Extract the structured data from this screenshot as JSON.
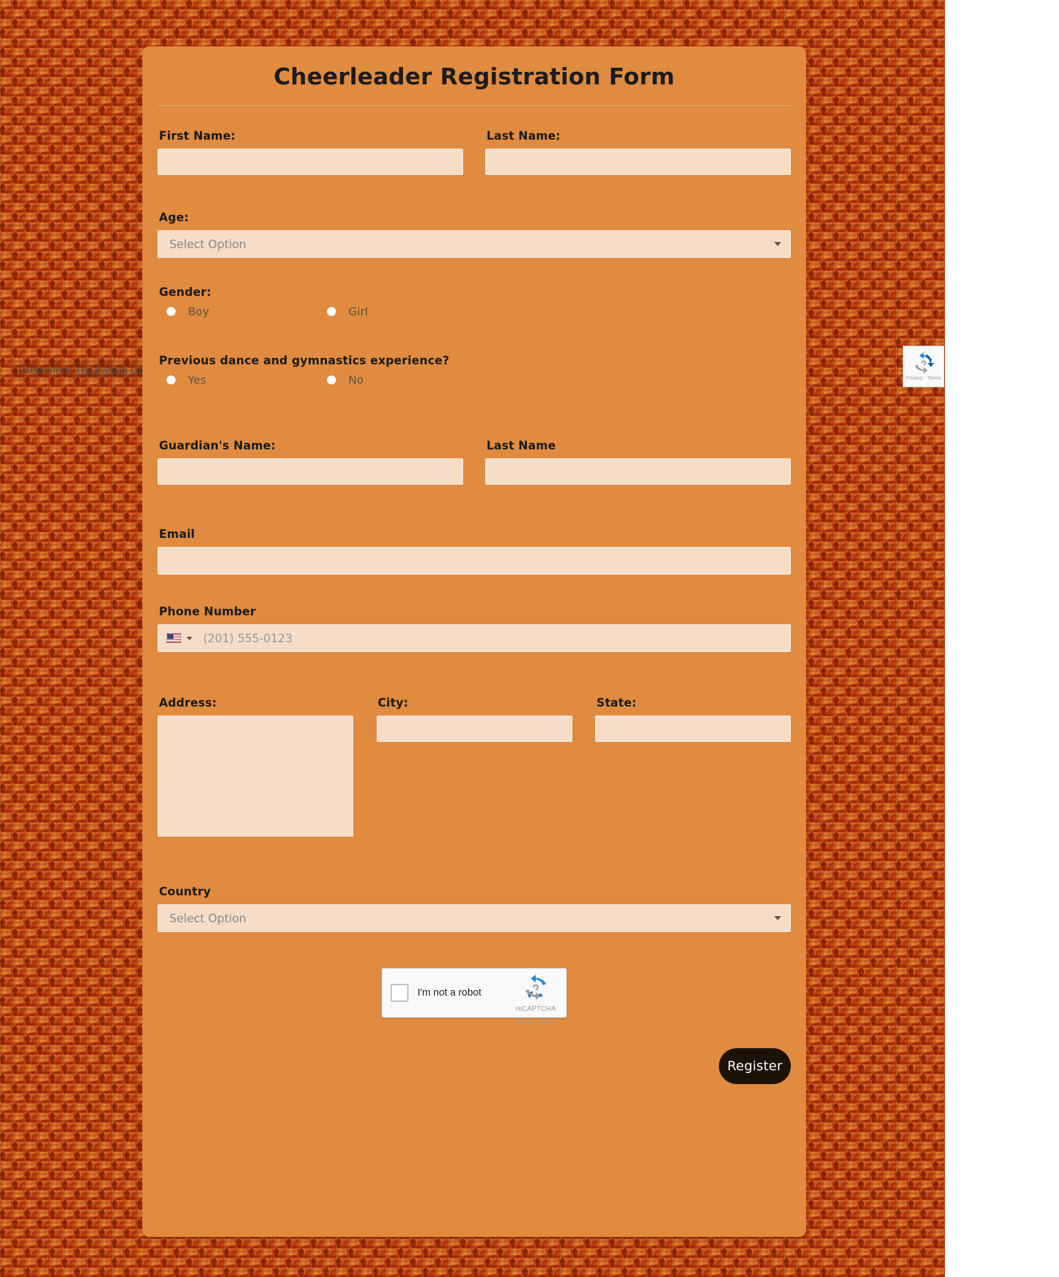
{
  "background": {
    "pattern_credit_prefix": "Pattern from ",
    "pattern_credit_link": "The Pattern Library",
    "pattern_color_light": "#e2742a",
    "pattern_color_dark": "#c8420e"
  },
  "card": {
    "title": "Cheerleader Registration Form",
    "background_color": "#e08b3f",
    "input_color": "#f5ddc8"
  },
  "fields": {
    "first_name": {
      "label": "First Name:",
      "value": "",
      "placeholder": ""
    },
    "last_name": {
      "label": "Last Name:",
      "value": "",
      "placeholder": ""
    },
    "age": {
      "label": "Age:",
      "selected": "Select Option"
    },
    "gender": {
      "label": "Gender:",
      "options": [
        {
          "label": "Boy",
          "selected": false
        },
        {
          "label": "Girl",
          "selected": false
        }
      ]
    },
    "experience": {
      "label": "Previous dance and gymnastics experience?",
      "options": [
        {
          "label": "Yes",
          "selected": false
        },
        {
          "label": "No",
          "selected": false
        }
      ]
    },
    "guardian_name": {
      "label": "Guardian's Name:",
      "value": "",
      "placeholder": ""
    },
    "guardian_last_name": {
      "label": "Last Name",
      "value": "",
      "placeholder": ""
    },
    "email": {
      "label": "Email",
      "value": "",
      "placeholder": ""
    },
    "phone": {
      "label": "Phone Number",
      "country_flag": "us-flag-icon",
      "placeholder": "(201) 555-0123",
      "value": ""
    },
    "address": {
      "label": "Address:",
      "value": "",
      "placeholder": ""
    },
    "city": {
      "label": "City:",
      "value": "",
      "placeholder": ""
    },
    "state": {
      "label": "State:",
      "value": "",
      "placeholder": ""
    },
    "country": {
      "label": "Country",
      "selected": "Select Option"
    }
  },
  "captcha": {
    "checkbox_label": "I'm not a robot",
    "brand": "reCAPTCHA",
    "legal": "Privacy - Terms"
  },
  "badge": {
    "legal": "Privacy - Terms"
  },
  "submit": {
    "label": "Register"
  }
}
